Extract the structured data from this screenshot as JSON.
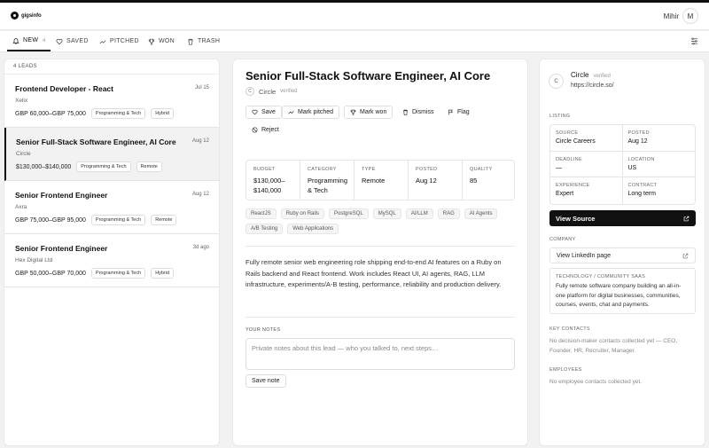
{
  "app": {
    "logo_text": "gigsinfo",
    "user_name": "Mihir",
    "avatar_initial": "M"
  },
  "tabs": [
    {
      "label": "NEW",
      "count": "4",
      "icon": "bell-icon",
      "active": true
    },
    {
      "label": "SAVED",
      "icon": "heart-icon"
    },
    {
      "label": "PITCHED",
      "icon": "trend-icon"
    },
    {
      "label": "WON",
      "icon": "trophy-icon"
    },
    {
      "label": "TRASH",
      "icon": "trash-icon"
    }
  ],
  "leads": {
    "count_label": "4 LEADS",
    "items": [
      {
        "title": "Frontend Developer - React",
        "date": "Jul 15",
        "company": "Xelix",
        "salary": "GBP 60,000–GBP 75,000",
        "tags": [
          "Programming & Tech",
          "Hybrid"
        ]
      },
      {
        "title": "Senior Full-Stack Software Engineer, AI Core",
        "date": "Aug 12",
        "company": "Circle",
        "salary": "$130,000–$140,000",
        "tags": [
          "Programming & Tech",
          "Remote"
        ],
        "selected": true
      },
      {
        "title": "Senior Frontend Engineer",
        "date": "Aug 12",
        "company": "Axra",
        "salary": "GBP 75,000–GBP 95,000",
        "tags": [
          "Programming & Tech",
          "Remote"
        ]
      },
      {
        "title": "Senior Frontend Engineer",
        "date": "3d ago",
        "company": "Hex Digital Ltd",
        "salary": "GBP 50,000–GBP 70,000",
        "tags": [
          "Programming & Tech",
          "Hybrid"
        ]
      }
    ]
  },
  "detail": {
    "title": "Senior Full-Stack Software Engineer, AI Core",
    "company_initial": "C",
    "company": "Circle",
    "verified": "verified",
    "actions": {
      "save": "Save",
      "mark_pitched": "Mark pitched",
      "mark_won": "Mark won",
      "dismiss": "Dismiss",
      "flag": "Flag",
      "reject": "Reject"
    },
    "stats": {
      "budget_label": "BUDGET",
      "budget_line1": "$130,000–",
      "budget_line2": "$140,000",
      "category_label": "CATEGORY",
      "category_line1": "Programming",
      "category_line2": "& Tech",
      "type_label": "TYPE",
      "type": "Remote",
      "posted_label": "POSTED",
      "posted": "Aug 12",
      "quality_label": "QUALITY",
      "quality": "85"
    },
    "tags": [
      "ReactJS",
      "Ruby on Rails",
      "PostgreSQL",
      "MySQL",
      "AI/LLM",
      "RAG",
      "AI Agents",
      "A/B Testing",
      "Web Applications"
    ],
    "description": "Fully remote senior web engineering role shipping end-to-end AI features on a Ruby on Rails backend and React frontend. Work includes React UI, AI agents, RAG, LLM infrastructure, experiments/A-B testing, performance, reliability and production delivery.",
    "notes_label": "YOUR NOTES",
    "notes_placeholder": "Private notes about this lead — who you talked to, next steps…",
    "save_note": "Save note"
  },
  "sidebar": {
    "company_initial": "C",
    "company": "Circle",
    "verified": "verified",
    "url": "https://circle.so/",
    "listing_label": "LISTING",
    "listing": {
      "source_label": "SOURCE",
      "source": "Circle Careers",
      "posted_label": "POSTED",
      "posted": "Aug 12",
      "deadline_label": "DEADLINE",
      "deadline": "—",
      "location_label": "LOCATION",
      "location": "US",
      "experience_label": "EXPERIENCE",
      "experience": "Expert",
      "contract_label": "CONTRACT",
      "contract": "Long term"
    },
    "view_source": "View Source",
    "company_label": "COMPANY",
    "linkedin": "View LinkedIn page",
    "tech_label": "TECHNOLOGY / COMMUNITY SAAS",
    "tech_text": "Fully remote software company building an all-in-one platform for digital businesses, communities, courses, events, chat and payments.",
    "key_contacts_label": "KEY CONTACTS",
    "key_contacts_text": "No decision-maker contacts collected yet — CEO, Founder, HR, Recruiter, Manager.",
    "employees_label": "EMPLOYEES",
    "employees_text": "No employee contacts collected yet."
  }
}
